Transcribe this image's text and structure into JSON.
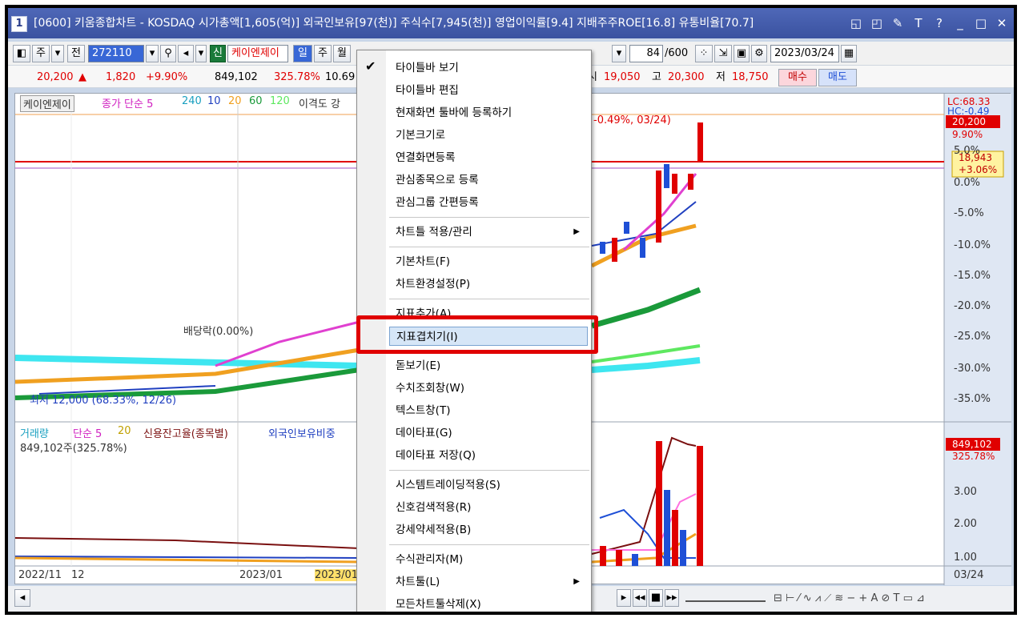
{
  "window": {
    "number": "1",
    "title": "[0600] 키움종합차트 - KOSDAQ 시가총액[1,605(억)] 외국인보유[97(천)] 주식수[7,945(천)] 영업이익률[9.4] 지배주주ROE[16.8] 유통비율[70.7]",
    "controls": [
      "◱",
      "◰",
      "✎",
      "T",
      "?",
      "_",
      "□",
      "✕"
    ]
  },
  "toolbar": {
    "period_btns": [
      "주",
      "전"
    ],
    "code": "272110",
    "stock_name": "케이엔제이",
    "new_badge": "신",
    "tabs": [
      "일",
      "주",
      "월"
    ],
    "count": "84",
    "count_total": "/600",
    "date": "2023/03/24"
  },
  "quote": {
    "price": "20,200",
    "change_arrow": "▲",
    "change": "1,820",
    "change_pct": "+9.90%",
    "volume": "849,102",
    "vol_ratio": "325.78%",
    "turnover": "10.69",
    "open_label": "시",
    "open": "19,050",
    "high_label": "고",
    "high": "20,300",
    "low_label": "저",
    "low": "18,750",
    "buy": "매수",
    "sell": "매도"
  },
  "chart": {
    "legend_top": [
      "케이엔제이",
      "종가 단순 5",
      "240",
      "10",
      "20",
      "60",
      "120",
      "이격도 강"
    ],
    "legend_bottom": [
      "거래량",
      "단순 5",
      "20",
      "신용잔고율(종목별)",
      "외국인보유비중"
    ],
    "volume_label": "849,102주(325.78%)",
    "annotation_div": "배당락(0.00%)",
    "annotation_low": "최저 12,000 (68.33%, 12/26)",
    "annotation_high": "-0.49%, 03/24)",
    "lc": "LC:68.33",
    "hc": "HC:-0.49",
    "price_label": "20,200",
    "pct_label": "9.90%",
    "cur_label": "18,943",
    "cur_pct": "+3.06%",
    "y_axis": [
      "5.0%",
      "0.0%",
      "-5.0%",
      "-10.0%",
      "-15.0%",
      "-20.0%",
      "-25.0%",
      "-30.0%",
      "-35.0%"
    ],
    "y_axis_vol": [
      "849,102",
      "325.78%",
      "3.00",
      "2.00",
      "1.00"
    ],
    "x_axis": [
      "2022/11",
      "12",
      "2023/01",
      "2023/01",
      "03/24"
    ]
  },
  "menu": {
    "items": [
      {
        "label": "타이틀바 보기",
        "checked": true
      },
      {
        "label": "타이틀바 편집"
      },
      {
        "label": "현재화면 툴바에 등록하기"
      },
      {
        "label": "기본크기로"
      },
      {
        "label": "연결화면등록"
      },
      {
        "label": "관심종목으로 등록"
      },
      {
        "label": "관심그룹 간편등록"
      },
      {
        "label": "차트틀 적용/관리",
        "submenu": true
      },
      {
        "label": "기본차트(F)"
      },
      {
        "label": "차트환경설정(P)"
      },
      {
        "label": "지표추가(A)"
      },
      {
        "label": "지표겹치기(I)",
        "highlighted": true
      },
      {
        "label": "돋보기(E)"
      },
      {
        "label": "수치조회창(W)"
      },
      {
        "label": "텍스트창(T)"
      },
      {
        "label": "데이타표(G)"
      },
      {
        "label": "데이타표 저장(Q)"
      },
      {
        "label": "시스템트레이딩적용(S)"
      },
      {
        "label": "신호검색적용(R)"
      },
      {
        "label": "강세약세적용(B)"
      },
      {
        "label": "수식관리자(M)"
      },
      {
        "label": "차트툴(L)",
        "submenu": true
      },
      {
        "label": "모든차트툴삭제(X)"
      }
    ]
  },
  "colors": {
    "accent": "#e00000",
    "title_bg": "#4f68b8",
    "highlight": "#d6e6f7",
    "up": "#e00000",
    "down": "#1e4fd6"
  }
}
